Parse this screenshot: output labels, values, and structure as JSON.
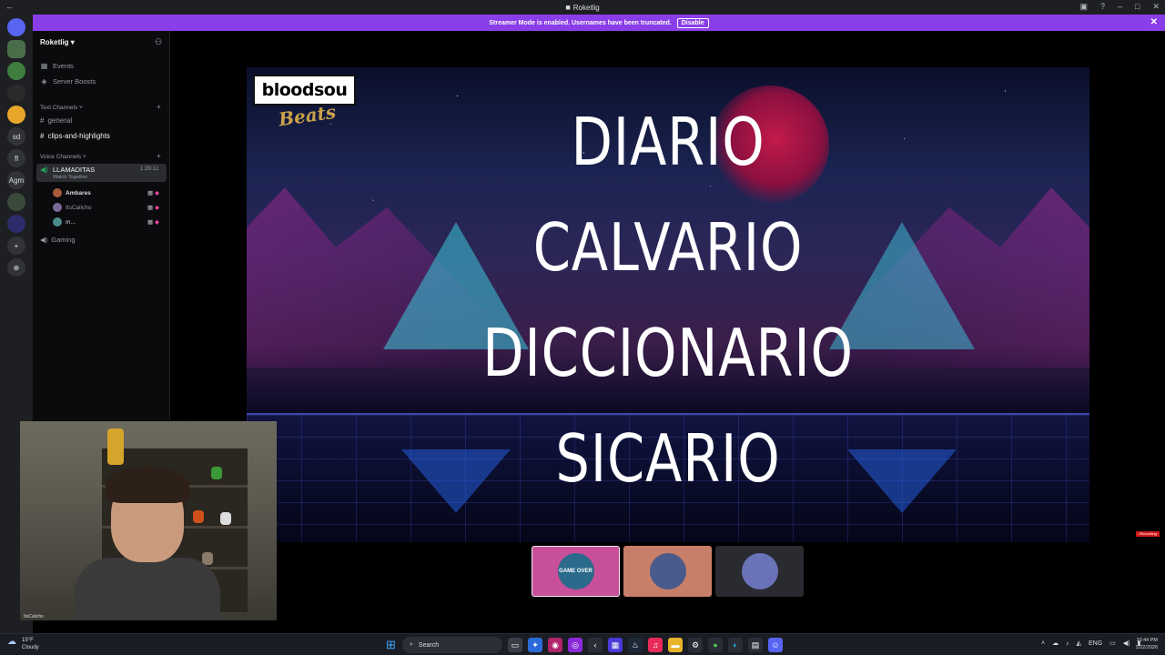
{
  "window": {
    "title": "Roketlig"
  },
  "banner": {
    "text": "Streamer Mode is enabled. Usernames have been truncated.",
    "button": "Disable"
  },
  "rail": {
    "items": [
      {
        "name": "discord-home",
        "label": "",
        "color": "#5865f2"
      },
      {
        "name": "server-1",
        "label": "",
        "color": "#4a6d4a"
      },
      {
        "name": "server-2",
        "label": "",
        "color": "#3e7d3e"
      },
      {
        "name": "server-3",
        "label": "",
        "color": "#2a2a2a"
      },
      {
        "name": "server-4",
        "label": "",
        "color": "#e8a72a"
      },
      {
        "name": "server-sd",
        "label": "sd",
        "color": "#313338"
      },
      {
        "name": "server-fl",
        "label": "fl",
        "color": "#313338"
      },
      {
        "name": "server-agm",
        "label": "Agm",
        "color": "#313338"
      },
      {
        "name": "server-5",
        "label": "",
        "color": "#3a4a3a"
      },
      {
        "name": "server-6",
        "label": "",
        "color": "#2c2c6a"
      },
      {
        "name": "add-server",
        "label": "+",
        "color": "#313338"
      },
      {
        "name": "explore",
        "label": "⊕",
        "color": "#313338"
      }
    ]
  },
  "sidebar": {
    "server_name": "Roketlig",
    "items": [
      {
        "label": "Events",
        "icon": "calendar-icon"
      },
      {
        "label": "Server Boosts",
        "icon": "boost-icon"
      }
    ],
    "text_category": "Text Channels",
    "text_channels": [
      {
        "label": "general",
        "active": false
      },
      {
        "label": "clips-and-highlights",
        "active": true
      }
    ],
    "voice_category": "Voice Channels",
    "voice_channel": {
      "label": "LLAMADITAS",
      "timer": "1:29:12",
      "activity": "Watch Together"
    },
    "voice_users": [
      {
        "name": "Ambares",
        "color": "#a85a3a"
      },
      {
        "name": "ItsCalicho",
        "color": "#7a6a9a"
      },
      {
        "name": "m...",
        "color": "#4a8a8a"
      }
    ],
    "other_voice": "Gaming"
  },
  "stream": {
    "brand_top": "bloodsou",
    "brand_script": "Beats",
    "words": [
      "DIARIO",
      "CALVARIO",
      "DICCIONARIO",
      "SICARIO"
    ]
  },
  "participants": [
    {
      "label": "GAME OVER",
      "bg": "#c84f9a",
      "avatar": "#2b6a8a"
    },
    {
      "label": "",
      "bg": "#c87f6a",
      "avatar": "#4a5a8a"
    },
    {
      "label": "",
      "bg": "#2a2b30",
      "avatar": "#6a72b8"
    }
  ],
  "webcam": {
    "caption": "ItsCalicho"
  },
  "rec_badge": "•Recording",
  "taskbar": {
    "weather_temp": "15°F",
    "weather_cond": "Cloudy",
    "search": "Search",
    "tray_lang": "ENG",
    "time": "10:44 PM",
    "date": "1/22/2026"
  }
}
